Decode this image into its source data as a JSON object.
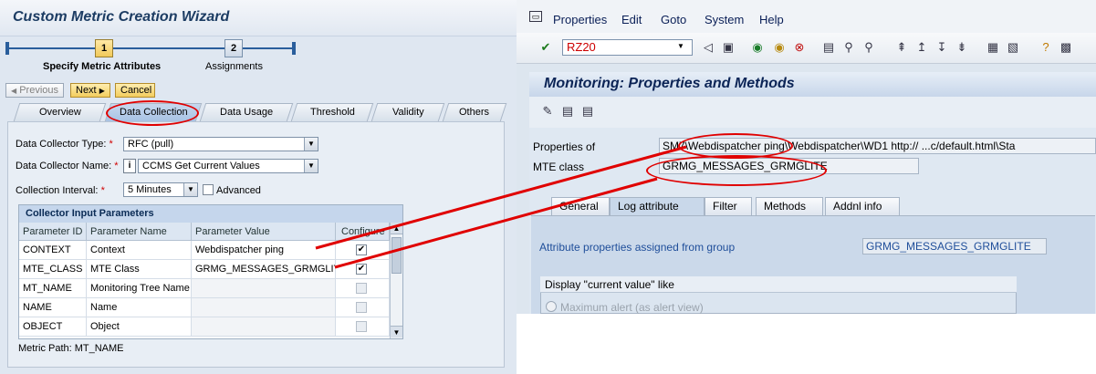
{
  "wizard": {
    "title": "Custom Metric Creation Wizard",
    "steps": [
      {
        "number": "1",
        "label": "Specify Metric Attributes",
        "active": true
      },
      {
        "number": "2",
        "label": "Assignments",
        "active": false
      }
    ],
    "buttons": {
      "previous": "Previous",
      "next": "Next",
      "cancel": "Cancel"
    },
    "tabs": [
      "Overview",
      "Data Collection",
      "Data Usage",
      "Threshold",
      "Validity",
      "Others"
    ],
    "active_tab": "Data Collection",
    "form": {
      "collector_type_label": "Data Collector Type:",
      "collector_type_value": "RFC (pull)",
      "collector_name_label": "Data Collector Name:",
      "collector_name_value": "CCMS Get Current Values",
      "collector_name_info": "i",
      "interval_label": "Collection Interval:",
      "interval_value": "5 Minutes",
      "advanced_label": "Advanced",
      "required_mark": "*"
    },
    "table": {
      "title": "Collector Input Parameters",
      "columns": [
        "Parameter ID",
        "Parameter Name",
        "Parameter Value",
        "Configure"
      ],
      "rows": [
        {
          "id": "CONTEXT",
          "name": "Context",
          "value": "Webdispatcher ping",
          "configure": true
        },
        {
          "id": "MTE_CLASS",
          "name": "MTE Class",
          "value": "GRMG_MESSAGES_GRMGLITE",
          "configure": true
        },
        {
          "id": "MT_NAME",
          "name": "Monitoring Tree Name",
          "value": "",
          "configure": false
        },
        {
          "id": "NAME",
          "name": "Name",
          "value": "",
          "configure": false
        },
        {
          "id": "OBJECT",
          "name": "Object",
          "value": "",
          "configure": false
        }
      ]
    },
    "metric_path": "Metric Path:  MT_NAME"
  },
  "sap": {
    "menu": [
      "Properties",
      "Edit",
      "Goto",
      "System",
      "Help"
    ],
    "command_field": "RZ20",
    "title": "Monitoring: Properties and Methods",
    "properties_of_label": "Properties of",
    "properties_of_value": "SM7\\Webdispatcher ping\\Webdispatcher\\WD1 http://            ...c/default.html\\Sta",
    "mte_class_label": "MTE class",
    "mte_class_value": "GRMG_MESSAGES_GRMGLITE",
    "tabs": [
      "General",
      "Log attribute",
      "Filter",
      "Methods",
      "Addnl info"
    ],
    "active_tab": "Log attribute",
    "attr_label": "Attribute properties assigned from group",
    "attr_value": "GRMG_MESSAGES_GRMGLITE",
    "group_title": "Display \"current value\" like",
    "radio_label": "Maximum alert (as alert view)"
  },
  "colors": {
    "annotation": "#e00000",
    "wizard_bg": "#dfe7f1",
    "sap_bg": "#dde6ef",
    "link_text": "#1f4e9a"
  }
}
